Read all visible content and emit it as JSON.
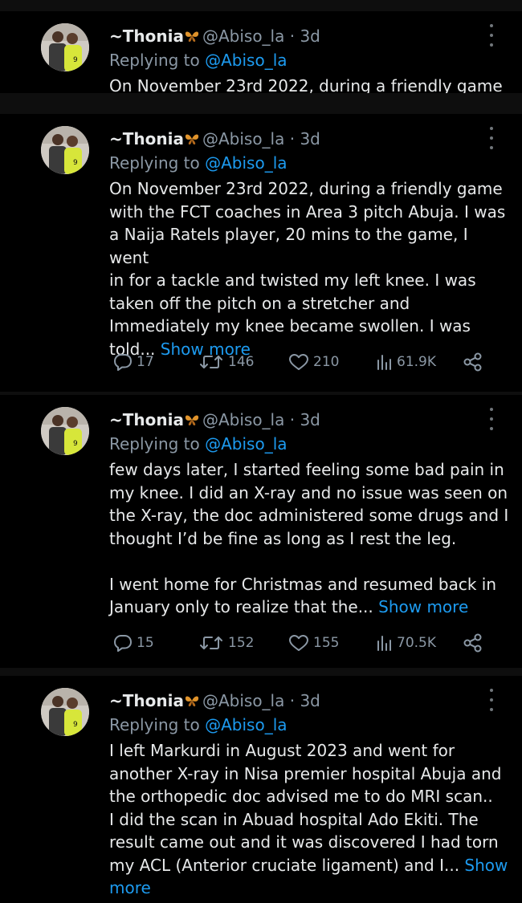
{
  "tweets": [
    {
      "name": "~Thonia",
      "handle": "@Abiso_la · 3d",
      "replying_prefix": "Replying to",
      "replying_to": "@Abiso_la",
      "lines": [
        "On November 23rd 2022, during a friendly game"
      ]
    },
    {
      "name": "~Thonia",
      "handle": "@Abiso_la · 3d",
      "replying_prefix": "Replying to",
      "replying_to": "@Abiso_la",
      "lines": [
        "On November 23rd 2022, during a friendly game",
        "with the FCT coaches in Area 3 pitch Abuja. I was",
        "a Naija Ratels player, 20 mins to the game, I went",
        "in for a tackle and twisted my left knee. I was",
        "taken off the pitch on a stretcher and",
        "Immediately my knee became swollen. I was"
      ],
      "last_line": "told... ",
      "show_more": "Show more",
      "replies": "17",
      "retweets": "146",
      "likes": "210",
      "views": "61.9K"
    },
    {
      "name": "~Thonia",
      "handle": "@Abiso_la · 3d",
      "replying_prefix": "Replying to",
      "replying_to": "@Abiso_la",
      "lines": [
        "few days later, I started feeling some bad pain in",
        "my knee. I did an X-ray and no issue was seen on",
        "the X-ray, the doc administered some drugs and I",
        "thought I’d be fine as long as I rest the leg."
      ],
      "lines2": [
        "I went home for Christmas and resumed back in"
      ],
      "last_line": "January only to realize that the... ",
      "show_more": "Show more",
      "replies": "15",
      "retweets": "152",
      "likes": "155",
      "views": "70.5K"
    },
    {
      "name": "~Thonia",
      "handle": "@Abiso_la · 3d",
      "replying_prefix": "Replying to",
      "replying_to": "@Abiso_la",
      "lines": [
        "I left Markurdi in August 2023 and went for",
        "another X-ray in Nisa premier hospital Abuja and",
        "the orthopedic doc advised me to do MRI scan..",
        "I did the scan in Abuad hospital Ado Ekiti. The",
        "result came out and it was discovered I had torn"
      ],
      "last_line": "my ACL (Anterior cruciate ligament) and I... ",
      "show_more_a": "Show",
      "show_more_b": "more"
    }
  ],
  "icons": {
    "avatar": "avatar-photo",
    "badge": "butterfly-emoji",
    "reply": "comment-icon",
    "retweet": "retweet-icon",
    "like": "heart-icon",
    "views": "views-icon",
    "share": "share-icon",
    "more": "more-vertical-icon"
  },
  "colors": {
    "background": "#000000",
    "separator": "#0e0e0e",
    "link": "#1d9bf0",
    "muted": "#8b98a5"
  }
}
